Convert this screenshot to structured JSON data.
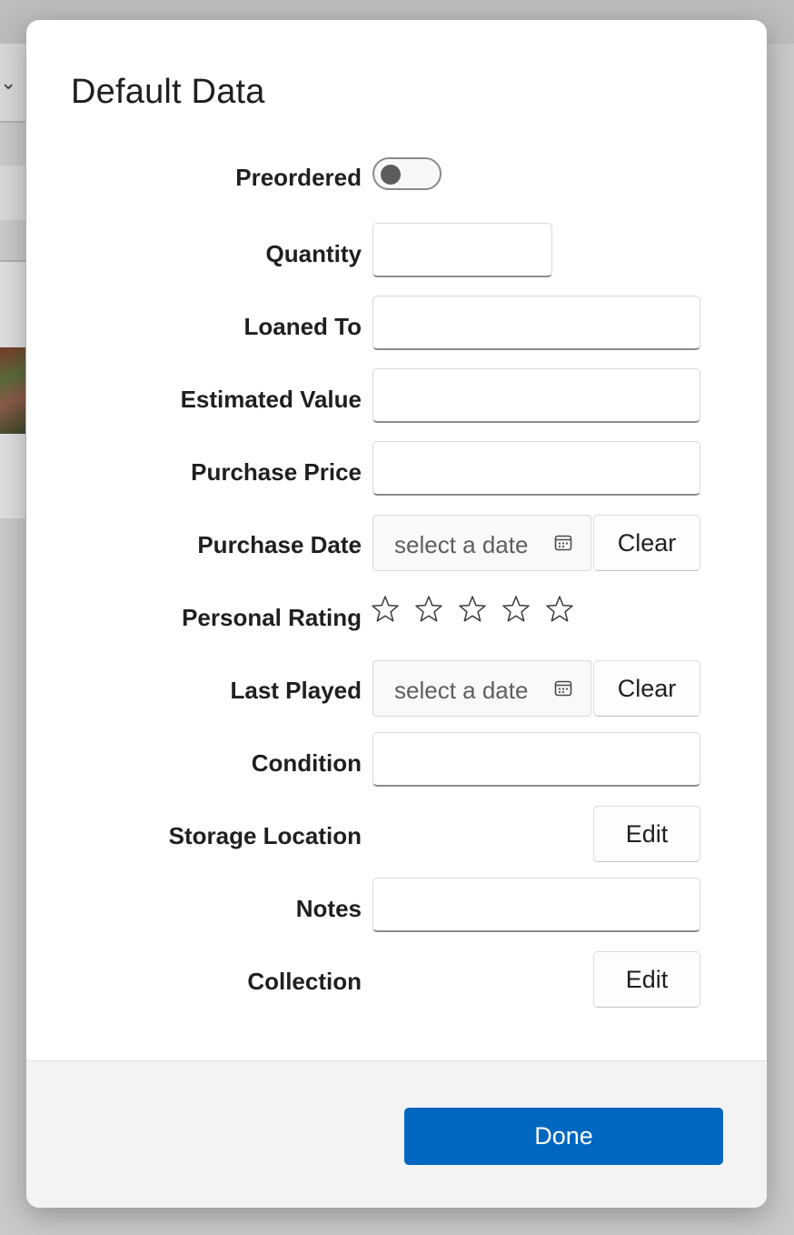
{
  "dialog": {
    "title": "Default Data",
    "fields": {
      "preordered": {
        "label": "Preordered",
        "toggle_on": false
      },
      "quantity": {
        "label": "Quantity",
        "value": ""
      },
      "loaned_to": {
        "label": "Loaned To",
        "value": ""
      },
      "estimated_value": {
        "label": "Estimated Value",
        "value": ""
      },
      "purchase_price": {
        "label": "Purchase Price",
        "value": ""
      },
      "purchase_date": {
        "label": "Purchase Date",
        "placeholder": "select a date",
        "clear_label": "Clear"
      },
      "personal_rating": {
        "label": "Personal Rating",
        "max_stars": 5,
        "value": 0
      },
      "last_played": {
        "label": "Last Played",
        "placeholder": "select a date",
        "clear_label": "Clear"
      },
      "condition": {
        "label": "Condition",
        "value": ""
      },
      "storage_location": {
        "label": "Storage Location",
        "edit_label": "Edit"
      },
      "notes": {
        "label": "Notes",
        "value": ""
      },
      "collection": {
        "label": "Collection",
        "edit_label": "Edit"
      }
    },
    "footer": {
      "done_label": "Done"
    }
  },
  "colors": {
    "accent": "#0067c0",
    "dialog_bg": "#ffffff",
    "footer_bg": "#f3f3f3"
  },
  "icons": {
    "calendar": "calendar-icon",
    "star": "star-outline-icon"
  }
}
